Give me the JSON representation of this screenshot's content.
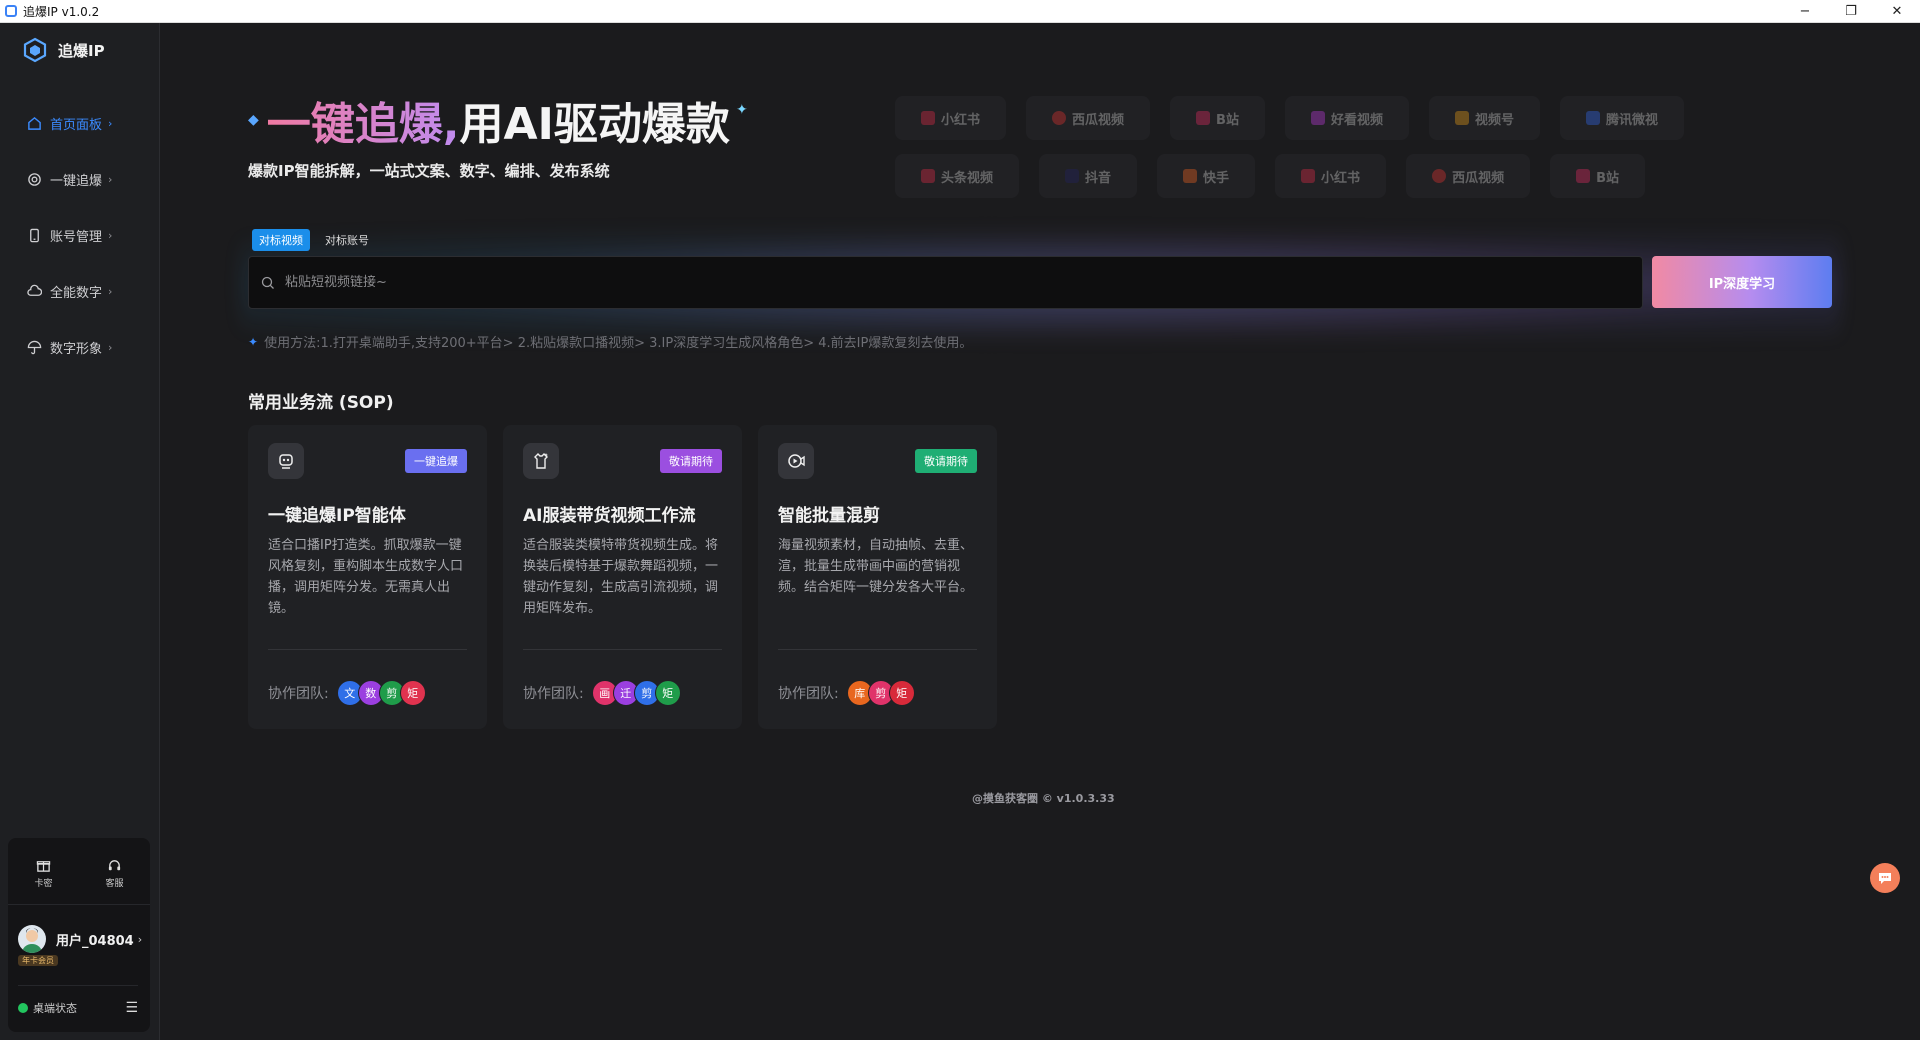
{
  "window": {
    "title": "追爆IP v1.0.2",
    "minimize": "−",
    "restore": "❐",
    "close": "✕"
  },
  "sidebar": {
    "logo_text": "追爆IP",
    "items": [
      {
        "label": "首页面板",
        "icon": "home-icon"
      },
      {
        "label": "一键追爆",
        "icon": "target-icon"
      },
      {
        "label": "账号管理",
        "icon": "phone-icon"
      },
      {
        "label": "全能数字",
        "icon": "cloud-icon"
      },
      {
        "label": "数字形象",
        "icon": "umbrella-icon"
      }
    ],
    "chevron": "›",
    "card_label": "卡密",
    "service_label": "客服",
    "username": "用户_04804",
    "vip_badge": "年卡会员",
    "status_label": "桌端状态",
    "status_color": "#22c55e"
  },
  "hero": {
    "title_highlight": "一键追爆,",
    "title_rest": "用AI驱动爆款",
    "subtitle": "爆款IP智能拆解，一站式文案、数字、编排、发布系统",
    "platforms_row1": [
      "小红书",
      "西瓜视频",
      "B站",
      "好看视频",
      "视频号",
      "腾讯微视"
    ],
    "platforms_row2": [
      "头条视频",
      "抖音",
      "快手",
      "小红书",
      "西瓜视频",
      "B站"
    ]
  },
  "search": {
    "tabs": [
      "对标视频",
      "对标账号"
    ],
    "placeholder": "粘贴短视频链接~",
    "button_label": "IP深度学习",
    "usage": "使用方法:1.打开桌端助手,支持200+平台> 2.粘贴爆款口播视频> 3.IP深度学习生成风格角色> 4.前去IP爆款复刻去使用。"
  },
  "sop": {
    "title": "常用业务流 (SOP)",
    "team_label": "协作团队:",
    "cards": [
      {
        "icon": "robot-icon",
        "tag": "一键追爆",
        "tag_color": "#6a6ff0",
        "title": "一键追爆IP智能体",
        "desc": "适合口播IP打造类。抓取爆款一键风格复刻，重构脚本生成数字人口播，调用矩阵分发。无需真人出镜。",
        "team": [
          {
            "t": "文",
            "c": "#2f6fe8"
          },
          {
            "t": "数",
            "c": "#9b3fe0"
          },
          {
            "t": "剪",
            "c": "#1f9c4a"
          },
          {
            "t": "矩",
            "c": "#e0334f"
          }
        ]
      },
      {
        "icon": "shirt-icon",
        "tag": "敬请期待",
        "tag_color": "#9b4fe0",
        "title": "AI服装带货视频工作流",
        "desc": "适合服装类模特带货视频生成。将换装后模特基于爆款舞蹈视频，一键动作复刻，生成高引流视频，调用矩阵发布。",
        "team": [
          {
            "t": "画",
            "c": "#e0336a"
          },
          {
            "t": "迁",
            "c": "#9b3fe0"
          },
          {
            "t": "剪",
            "c": "#2f6fe8"
          },
          {
            "t": "矩",
            "c": "#1f9c4a"
          }
        ]
      },
      {
        "icon": "video-camera-icon",
        "tag": "敬请期待",
        "tag_color": "#1fae74",
        "title": "智能批量混剪",
        "desc": "海量视频素材，自动抽帧、去重、渲，批量生成带画中画的营销视频。结合矩阵一键分发各大平台。",
        "team": [
          {
            "t": "库",
            "c": "#e8671f"
          },
          {
            "t": "剪",
            "c": "#e0336a"
          },
          {
            "t": "矩",
            "c": "#d82a3a"
          }
        ]
      }
    ]
  },
  "footer": "@摸鱼获客圈 © v1.0.3.33"
}
